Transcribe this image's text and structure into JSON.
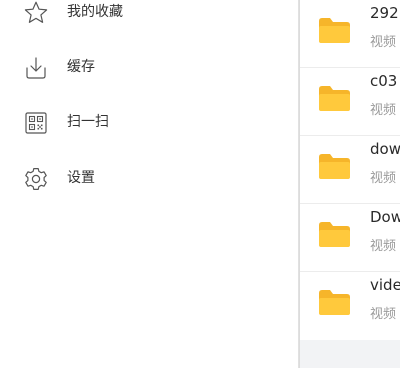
{
  "drawer": {
    "items": [
      {
        "label": "我的收藏",
        "icon": "star-icon"
      },
      {
        "label": "缓存",
        "icon": "download-icon"
      },
      {
        "label": "扫一扫",
        "icon": "qr-code-icon"
      },
      {
        "label": "设置",
        "icon": "gear-icon"
      }
    ]
  },
  "files": [
    {
      "name": "292",
      "meta": "视频"
    },
    {
      "name": "c03",
      "meta": "视频"
    },
    {
      "name": "dow",
      "meta": "视频"
    },
    {
      "name": "Dow",
      "meta": "视频"
    },
    {
      "name": "vide",
      "meta": "视频"
    }
  ],
  "colors": {
    "folder": "#FFC93C",
    "folder_tab": "#F6B52A",
    "text_primary": "#333333",
    "text_secondary": "#9a9a9a"
  }
}
